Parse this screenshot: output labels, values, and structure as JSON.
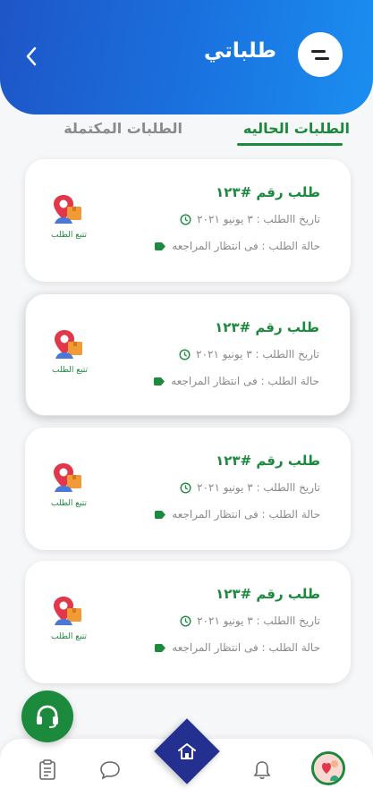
{
  "header": {
    "title": "طلباتي"
  },
  "tabs": {
    "current": "الطلبات الحاليه",
    "completed": "الطلبات المكتملة"
  },
  "orders": [
    {
      "title": "طلب رقم #١٢٣",
      "date": "تاريخ االطلب : ٣ يونيو ٢٠٢١",
      "status": "حالة الطلب : فى انتظار المراجعه",
      "track_label": "تتبع الطلب"
    },
    {
      "title": "طلب رقم #١٢٣",
      "date": "تاريخ االطلب : ٣ يونيو ٢٠٢١",
      "status": "حالة الطلب : فى انتظار المراجعه",
      "track_label": "تتبع الطلب"
    },
    {
      "title": "طلب رقم #١٢٣",
      "date": "تاريخ االطلب : ٣ يونيو ٢٠٢١",
      "status": "حالة الطلب : فى انتظار المراجعه",
      "track_label": "تتبع الطلب"
    },
    {
      "title": "طلب رقم #١٢٣",
      "date": "تاريخ االطلب : ٣ يونيو ٢٠٢١",
      "status": "حالة الطلب : فى انتظار المراجعه",
      "track_label": "تتبع الطلب"
    }
  ],
  "colors": {
    "primary_green": "#1b8a3d",
    "header_blue": "#1a73e0",
    "home_navy": "#23308f"
  },
  "icons": {
    "back": "chevron-left-icon",
    "menu": "menu-icon",
    "clock": "clock-icon",
    "status": "tag-icon",
    "track": "map-pin-box-icon",
    "support": "headset-icon",
    "orders": "clipboard-icon",
    "chat": "chat-icon",
    "home": "home-icon",
    "notifications": "bell-icon",
    "profile": "avatar"
  }
}
